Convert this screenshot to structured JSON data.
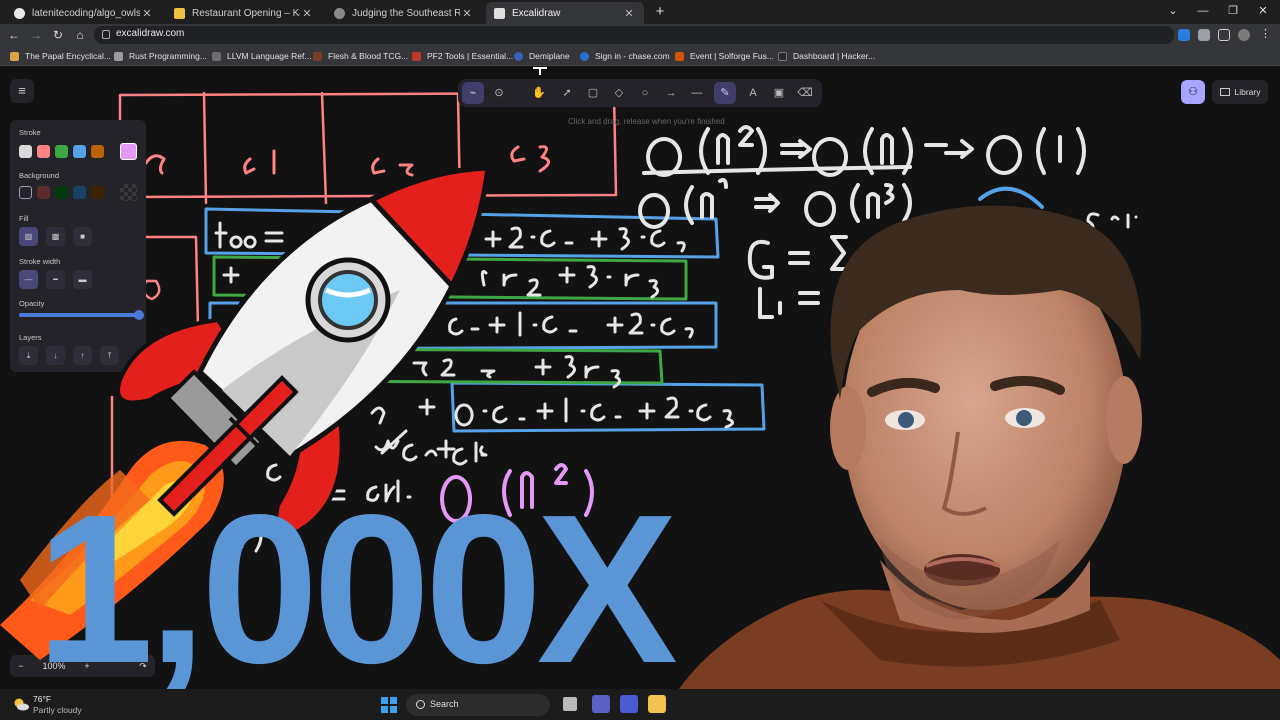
{
  "browser": {
    "tabs": [
      {
        "title": "latenitecoding/algo_owls: A repo",
        "active": false
      },
      {
        "title": "Restaurant Opening – Kattis, Katt",
        "active": false
      },
      {
        "title": "Judging the Southeast Region",
        "active": false
      },
      {
        "title": "Excalidraw",
        "active": true
      }
    ],
    "url": "excalidraw.com",
    "bookmarks": [
      "The Papal Encyclical...",
      "Rust Programming...",
      "LLVM Language Ref...",
      "Flesh & Blood TCG...",
      "PF2 Tools | Essential...",
      "Demiplane",
      "Sign in - chase.com",
      "Event | Solforge Fus...",
      "Dashboard | Hacker..."
    ]
  },
  "excalidraw": {
    "hint": "Click and drag, release when you're finished",
    "library_label": "Library",
    "properties": {
      "stroke_label": "Stroke",
      "background_label": "Background",
      "fill_label": "Fill",
      "stroke_width_label": "Stroke width",
      "opacity_label": "Opacity",
      "layers_label": "Layers",
      "stroke_colors": [
        "#d9d9d9",
        "#ff8383",
        "#3fa845",
        "#56a2e8",
        "#b86200",
        "#e599f7"
      ],
      "background_colors": [
        "#232329",
        "#5c2b2b",
        "#043b0c",
        "#154163",
        "#3d2400"
      ],
      "opacity_value": 100
    },
    "zoom": {
      "minus": "−",
      "value": "100%",
      "plus": "+"
    }
  },
  "thumbnail": {
    "headline": "1,000X",
    "headline_color": "#5a96d6"
  },
  "taskbar": {
    "temperature": "76°F",
    "weather": "Partly cloudy",
    "search_label": "Search"
  }
}
